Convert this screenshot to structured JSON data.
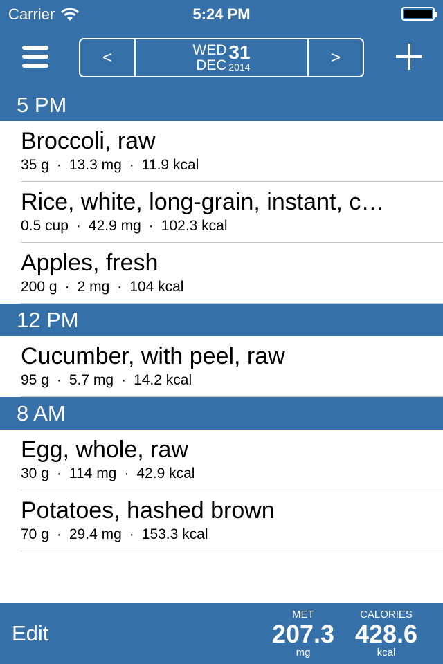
{
  "status_bar": {
    "carrier": "Carrier",
    "time": "5:24 PM"
  },
  "nav": {
    "prev_label": "<",
    "next_label": ">",
    "weekday": "WED",
    "month": "DEC",
    "day": "31",
    "year": "2014"
  },
  "sections": [
    {
      "header": "5 PM",
      "items": [
        {
          "name": "Broccoli, raw",
          "amount": "35 g",
          "mg": "13.3 mg",
          "kcal": "11.9 kcal"
        },
        {
          "name": "Rice, white, long-grain, instant, c…",
          "amount": "0.5 cup",
          "mg": "42.9 mg",
          "kcal": "102.3 kcal"
        },
        {
          "name": "Apples, fresh",
          "amount": "200 g",
          "mg": "2 mg",
          "kcal": "104 kcal"
        }
      ]
    },
    {
      "header": "12 PM",
      "items": [
        {
          "name": "Cucumber, with peel, raw",
          "amount": "95 g",
          "mg": "5.7 mg",
          "kcal": "14.2 kcal"
        }
      ]
    },
    {
      "header": "8 AM",
      "items": [
        {
          "name": "Egg, whole, raw",
          "amount": "30 g",
          "mg": "114 mg",
          "kcal": "42.9 kcal"
        },
        {
          "name": "Potatoes, hashed brown",
          "amount": "70 g",
          "mg": "29.4 mg",
          "kcal": "153.3 kcal"
        }
      ]
    }
  ],
  "separator": "·",
  "bottom_bar": {
    "edit_label": "Edit",
    "met": {
      "label": "MET",
      "value": "207.3",
      "unit": "mg"
    },
    "calories": {
      "label": "CALORIES",
      "value": "428.6",
      "unit": "kcal"
    }
  },
  "colors": {
    "accent": "#3670a9",
    "background": "#ffffff",
    "divider": "#c8c7cc"
  }
}
